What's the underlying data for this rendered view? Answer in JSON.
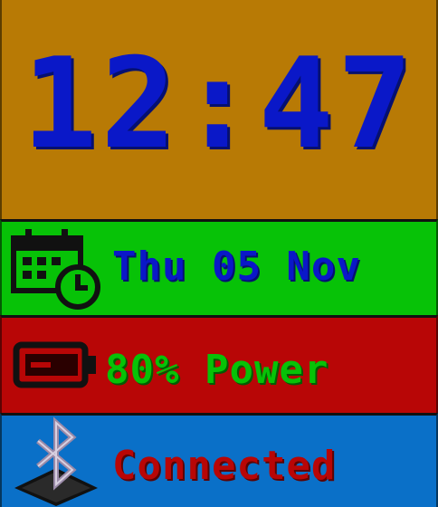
{
  "clock": {
    "time": "12:47"
  },
  "date": {
    "text": "Thu 05 Nov",
    "icon": "calendar-clock-icon"
  },
  "battery": {
    "text": "80% Power",
    "icon": "battery-icon",
    "level": 0.8
  },
  "bluetooth": {
    "text": "Connected",
    "icon": "bluetooth-icon"
  },
  "colors": {
    "clock_bg": "#b87a05",
    "clock_text": "#0a18c8",
    "date_bg": "#07c207",
    "date_text": "#0a18c8",
    "power_bg": "#b80606",
    "power_text": "#07c207",
    "bt_bg": "#0a70c8",
    "bt_text": "#b80606"
  }
}
